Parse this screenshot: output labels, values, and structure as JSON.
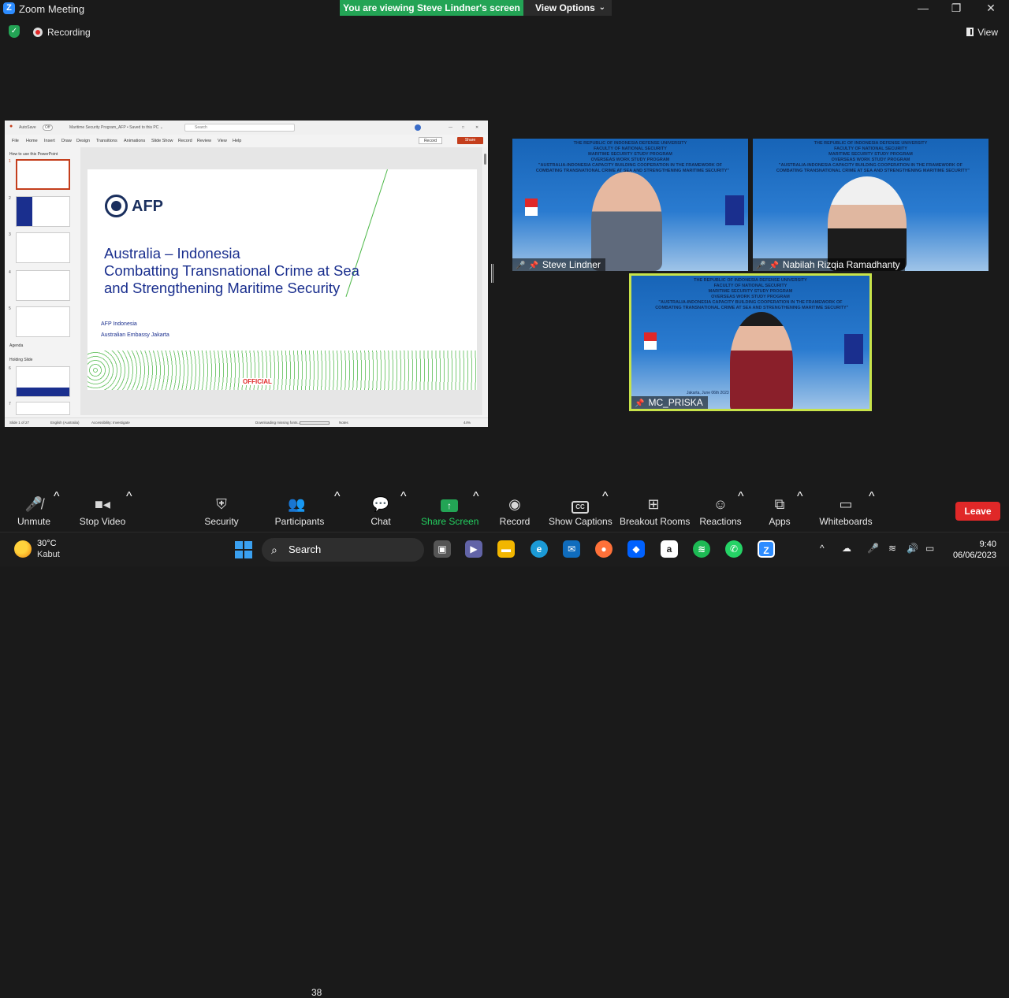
{
  "window": {
    "title": "Zoom Meeting",
    "view_options": "View Options",
    "share_banner": "You are viewing Steve Lindner's screen",
    "minimize": "—",
    "restore": "❐",
    "close": "✕"
  },
  "status": {
    "recording": "Recording",
    "view": "View"
  },
  "ppt": {
    "autosave": "AutoSave",
    "autosave_state": "Off",
    "filename": "Maritime Security Program_AFP • Saved to this PC ⌄",
    "search_placeholder": "Search",
    "menu": [
      "File",
      "Home",
      "Insert",
      "Draw",
      "Design",
      "Transitions",
      "Animations",
      "Slide Show",
      "Record",
      "Review",
      "View",
      "Help"
    ],
    "record_btn": "Record",
    "share_btn": "Share",
    "sections": {
      "how_to": "How to use this PowerPoint",
      "agenda": "Agenda",
      "holding": "Holding Slide"
    },
    "slide_numbers": [
      "1",
      "2",
      "3",
      "4",
      "5",
      "6",
      "7"
    ],
    "slide": {
      "logo": "AFP",
      "title": "Australia – Indonesia\nCombatting Transnational Crime at Sea\nand Strengthening Maritime Security",
      "sub1": "AFP Indonesia",
      "sub2": "Australian Embassy Jakarta",
      "official": "OFFICIAL"
    },
    "status": {
      "slide_of": "Slide 1 of 27",
      "lang": "English (Australia)",
      "access": "Accessibility: Investigate",
      "downloading": "Downloading missing fonts...",
      "notes": "Notes",
      "zoom": "44%"
    }
  },
  "tiles": [
    {
      "name": "Steve Lindner",
      "banner": "THE REPUBLIC OF INDONESIA DEFENSE UNIVERSITY\nFACULTY OF NATIONAL SECURITY\nMARITIME SECURITY STUDY PROGRAM\nOVERSEAS WORK STUDY PROGRAM\n\"AUSTRALIA-INDONESIA CAPACITY BUILDING COOPERATION IN THE FRAMEWORK OF\nCOMBATING TRANSNATIONAL CRIME AT SEA AND STRENGTHENING MARITIME SECURITY\""
    },
    {
      "name": "Nabilah Rizqia Ramadhanty",
      "banner": "THE REPUBLIC OF INDONESIA DEFENSE UNIVERSITY\nFACULTY OF NATIONAL SECURITY\nMARITIME SECURITY STUDY PROGRAM\nOVERSEAS WORK STUDY PROGRAM\n\"AUSTRALIA-INDONESIA CAPACITY BUILDING COOPERATION IN THE FRAMEWORK OF\nCOMBATING TRANSNATIONAL CRIME AT SEA AND STRENGTHENING MARITIME SECURITY\""
    },
    {
      "name": "MC_PRISKA",
      "banner": "THE REPUBLIC OF INDONESIA DEFENSE UNIVERSITY\nFACULTY OF NATIONAL SECURITY\nMARITIME SECURITY STUDY PROGRAM\nOVERSEAS WORK STUDY PROGRAM\n\"AUSTRALIA-INDONESIA CAPACITY BUILDING COOPERATION IN THE FRAMEWORK OF\nCOMBATING TRANSNATIONAL CRIME AT SEA AND STRENGTHENING MARITIME SECURITY\"",
      "footer": "Jakarta, June 06th 2023"
    }
  ],
  "toolbar": {
    "unmute": "Unmute",
    "stop_video": "Stop Video",
    "security": "Security",
    "participants": "Participants",
    "participants_count": "38",
    "chat": "Chat",
    "share_screen": "Share Screen",
    "record": "Record",
    "show_captions": "Show Captions",
    "cc": "CC",
    "breakout": "Breakout Rooms",
    "reactions": "Reactions",
    "apps": "Apps",
    "whiteboards": "Whiteboards",
    "leave": "Leave"
  },
  "taskbar": {
    "temp": "30°C",
    "condition": "Kabut",
    "search": "Search",
    "time": "9:40",
    "date": "06/06/2023"
  },
  "colors": {
    "zoom_blue": "#2d8cff",
    "green": "#23a455",
    "leave_red": "#e02828",
    "active_speaker": "#c8e34a",
    "ppt_accent": "#c43e1c"
  }
}
